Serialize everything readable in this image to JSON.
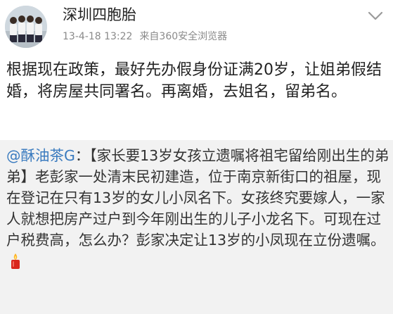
{
  "post": {
    "author": "深圳四胞胎",
    "timestamp": "13-4-18 13:22",
    "source": "来自360安全浏览器",
    "body": "根据现在政策，最好先办假身份证满20岁，让姐弟假结婚，将房屋共同署名。再离婚，去姐名，留弟名。",
    "menu_icon": "chevron-down-icon"
  },
  "repost": {
    "mention": "@酥油茶G",
    "colon": "：",
    "text": "【家长要13岁女孩立遗嘱将祖宅留给刚出生的弟弟】老彭家一处清末民初建造，位于南京新街口的祖屋，现在登记在只有13岁的女儿小凤名下。女孩终究要嫁人，一家人就想把房产过户到今年刚出生的儿子小龙名下。可现在过户税费高，怎么办？彭家决定让13岁的小凤现在立份遗嘱。",
    "emoji": "candle-icon"
  },
  "colors": {
    "mention": "#3a7bbf",
    "quote_bg": "#f2f2f2",
    "meta": "#8a8a8a"
  }
}
